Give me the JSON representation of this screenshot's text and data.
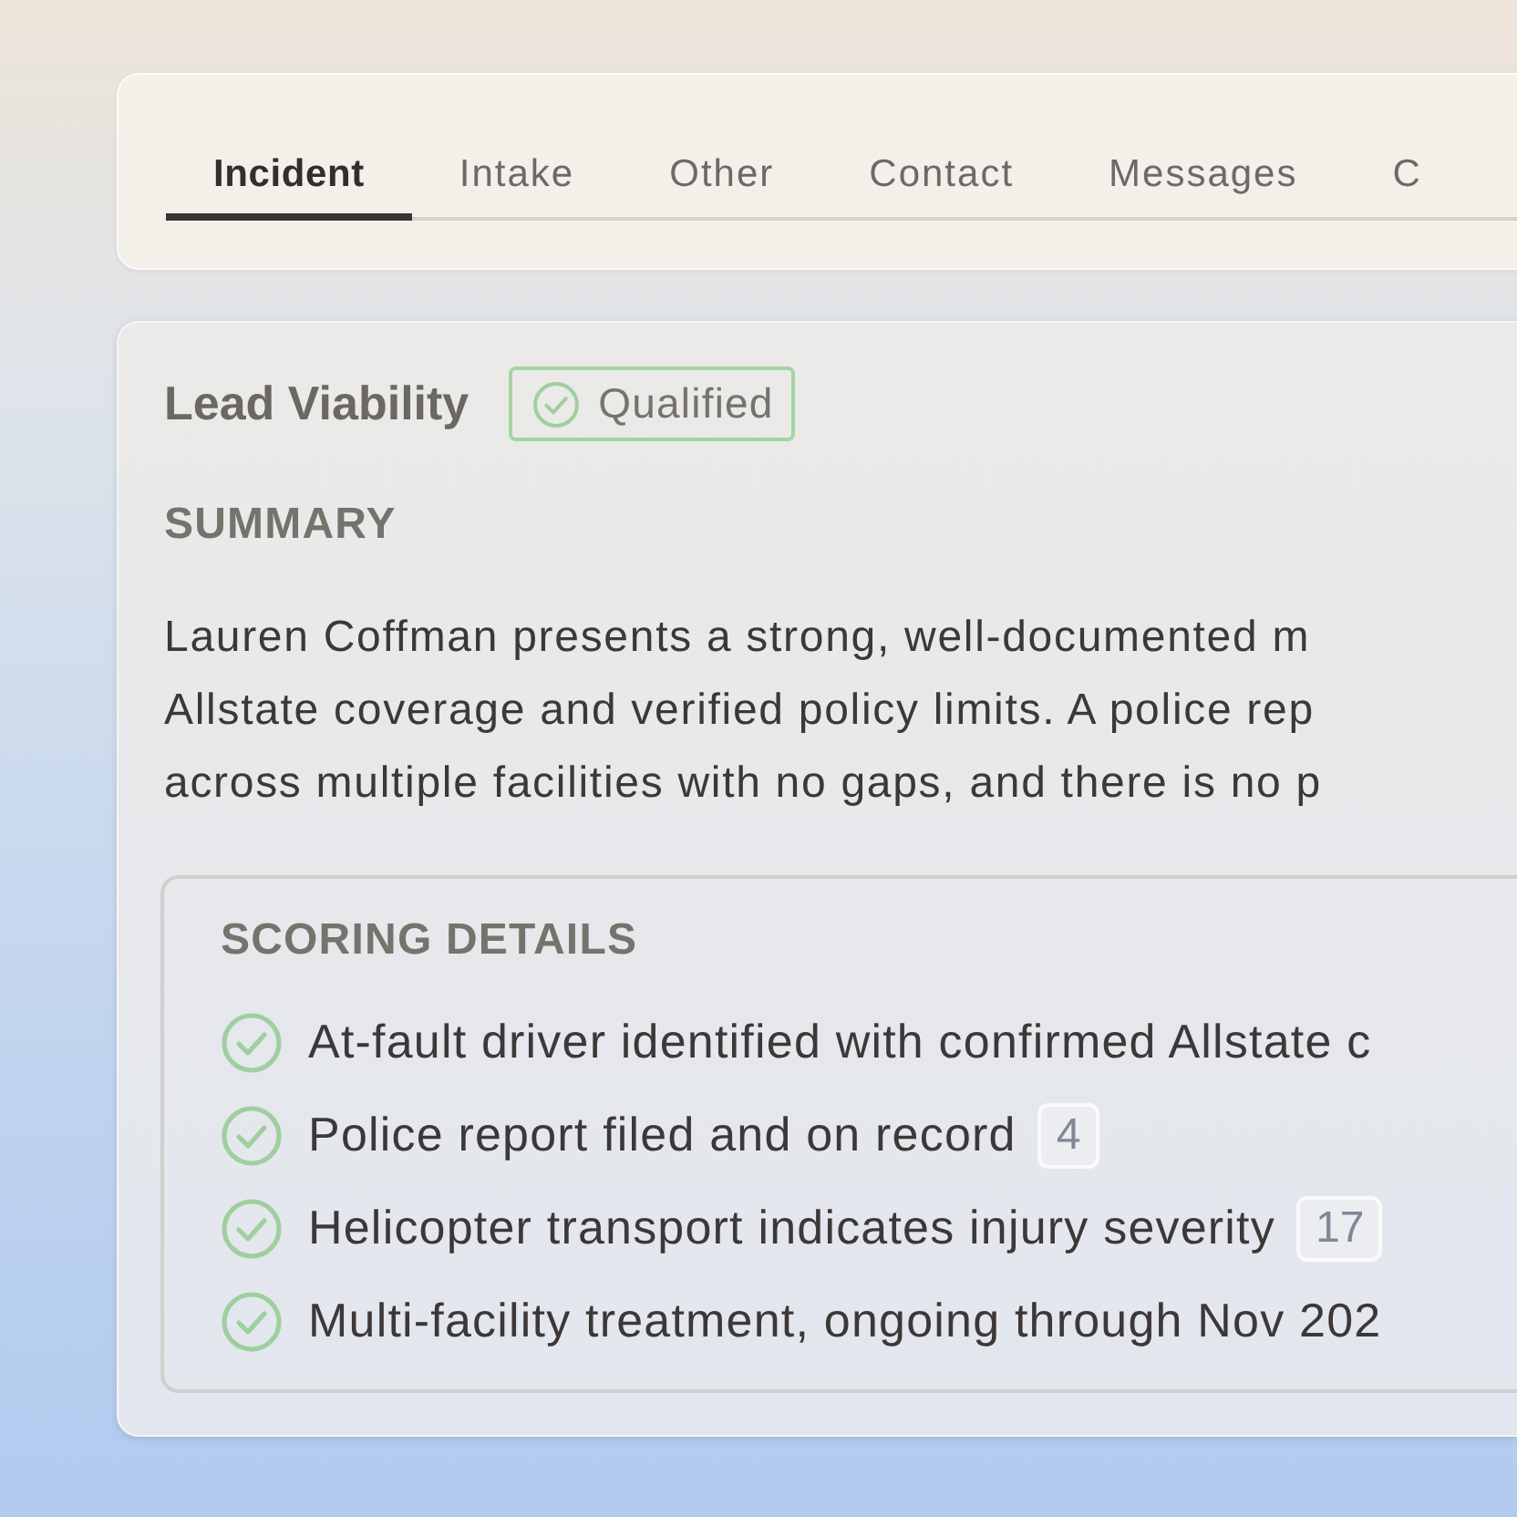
{
  "tabs": [
    {
      "label": "Incident",
      "selected": true
    },
    {
      "label": "Intake",
      "selected": false
    },
    {
      "label": "Other",
      "selected": false
    },
    {
      "label": "Contact",
      "selected": false
    },
    {
      "label": "Messages",
      "selected": false
    },
    {
      "label": "C",
      "selected": false
    }
  ],
  "lead_viability": {
    "title": "Lead Viability",
    "status": "Qualified",
    "summary_heading": "SUMMARY",
    "summary_lines": [
      "Lauren Coffman presents a strong, well-documented m",
      "Allstate coverage and verified policy limits. A police rep",
      "across multiple facilities with no gaps, and there is no p"
    ]
  },
  "scoring_details": {
    "heading": "SCORING DETAILS",
    "items": [
      {
        "text": "At-fault driver identified with confirmed Allstate c",
        "checked": true
      },
      {
        "text": "Police report filed and on record",
        "checked": true,
        "count": "4"
      },
      {
        "text": "Helicopter transport indicates injury severity",
        "checked": true,
        "count": "17"
      },
      {
        "text": "Multi-facility treatment, ongoing through Nov 202",
        "checked": true
      }
    ]
  }
}
